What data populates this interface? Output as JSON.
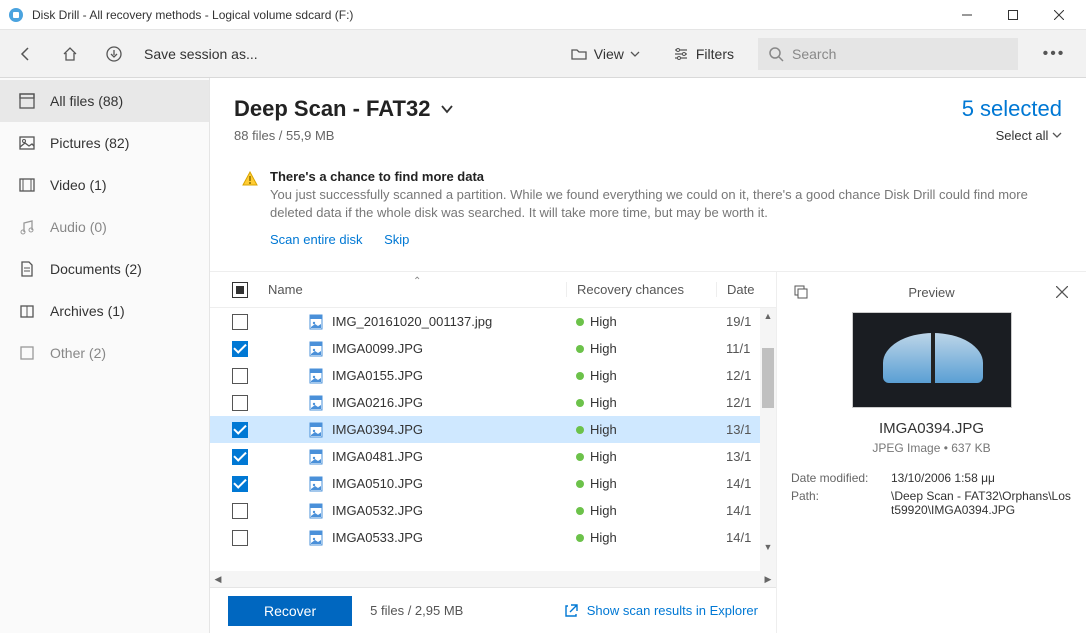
{
  "window": {
    "title": "Disk Drill - All recovery methods - Logical volume sdcard (F:)"
  },
  "toolbar": {
    "save_session": "Save session as...",
    "view": "View",
    "filters": "Filters",
    "search_placeholder": "Search"
  },
  "sidebar": {
    "items": [
      {
        "label": "All files (88)",
        "active": true
      },
      {
        "label": "Pictures (82)"
      },
      {
        "label": "Video (1)"
      },
      {
        "label": "Audio (0)",
        "dim": true
      },
      {
        "label": "Documents (2)"
      },
      {
        "label": "Archives (1)"
      },
      {
        "label": "Other (2)",
        "dim": true
      }
    ]
  },
  "header": {
    "title": "Deep Scan - FAT32",
    "subtitle": "88 files / 55,9 MB",
    "selected": "5 selected",
    "select_all": "Select all"
  },
  "notice": {
    "title": "There's a chance to find more data",
    "body": "You just successfully scanned a partition. While we found everything we could on it, there's a good chance Disk Drill could find more deleted data if the whole disk was searched. It will take more time, but may be worth it.",
    "scan_link": "Scan entire disk",
    "skip_link": "Skip"
  },
  "table": {
    "columns": {
      "name": "Name",
      "recovery": "Recovery chances",
      "date": "Date"
    },
    "rows": [
      {
        "name": "IMG_20161020_001137.jpg",
        "recovery": "High",
        "date": "19/1",
        "checked": false
      },
      {
        "name": "IMGA0099.JPG",
        "recovery": "High",
        "date": "11/1",
        "checked": true
      },
      {
        "name": "IMGA0155.JPG",
        "recovery": "High",
        "date": "12/1",
        "checked": false
      },
      {
        "name": "IMGA0216.JPG",
        "recovery": "High",
        "date": "12/1",
        "checked": false
      },
      {
        "name": "IMGA0394.JPG",
        "recovery": "High",
        "date": "13/1",
        "checked": true,
        "selected": true
      },
      {
        "name": "IMGA0481.JPG",
        "recovery": "High",
        "date": "13/1",
        "checked": true
      },
      {
        "name": "IMGA0510.JPG",
        "recovery": "High",
        "date": "14/1",
        "checked": true
      },
      {
        "name": "IMGA0532.JPG",
        "recovery": "High",
        "date": "14/1",
        "checked": false
      },
      {
        "name": "IMGA0533.JPG",
        "recovery": "High",
        "date": "14/1",
        "checked": false
      }
    ]
  },
  "preview": {
    "title": "Preview",
    "filename": "IMGA0394.JPG",
    "meta": "JPEG Image • 637 KB",
    "date_modified_label": "Date modified:",
    "date_modified": "13/10/2006 1:58 μμ",
    "path_label": "Path:",
    "path": "\\Deep Scan - FAT32\\Orphans\\Lost59920\\IMGA0394.JPG"
  },
  "footer": {
    "recover": "Recover",
    "meta": "5 files / 2,95 MB",
    "explorer": "Show scan results in Explorer"
  }
}
